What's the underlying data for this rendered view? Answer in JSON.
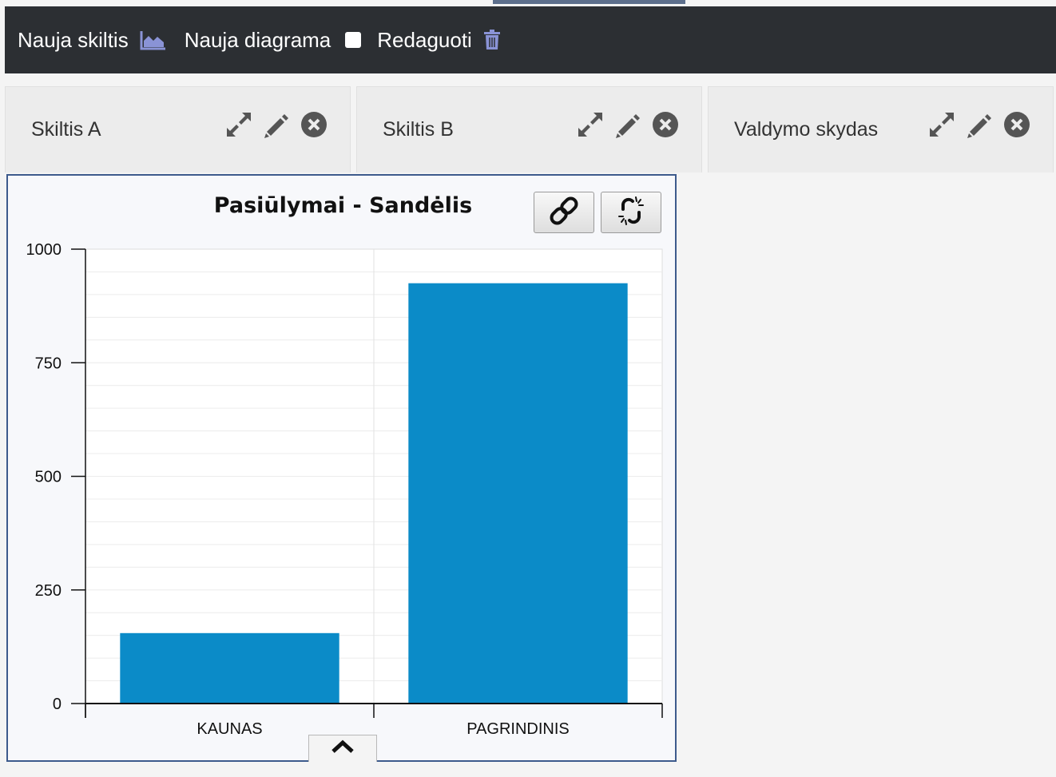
{
  "toolbar": {
    "new_section_label": "Nauja skiltis",
    "new_section_icon": "area-chart-icon",
    "new_chart_label": "Nauja diagrama",
    "edit_label": "Redaguoti",
    "delete_icon": "trash-icon",
    "icon_color": "#8a93d6"
  },
  "tabs": [
    {
      "label": "Skiltis A"
    },
    {
      "label": "Skiltis B"
    },
    {
      "label": "Valdymo skydas"
    }
  ],
  "tab_icons": [
    "expand-icon",
    "pencil-icon",
    "close-circle-icon"
  ],
  "panel": {
    "title": "Pasiūlymai - Sandėlis",
    "link_icon": "link-icon",
    "unlink_icon": "unlink-icon",
    "collapse_icon": "chevron-up-icon",
    "border_color": "#3d5a8c"
  },
  "chart_data": {
    "type": "bar",
    "categories": [
      "KAUNAS",
      "PAGRINDINIS"
    ],
    "values": [
      155,
      925
    ],
    "ylim": [
      0,
      1000
    ],
    "yticks": [
      0,
      250,
      500,
      750,
      1000
    ],
    "minor_gridlines": true,
    "bar_color": "#0b8bc8"
  }
}
